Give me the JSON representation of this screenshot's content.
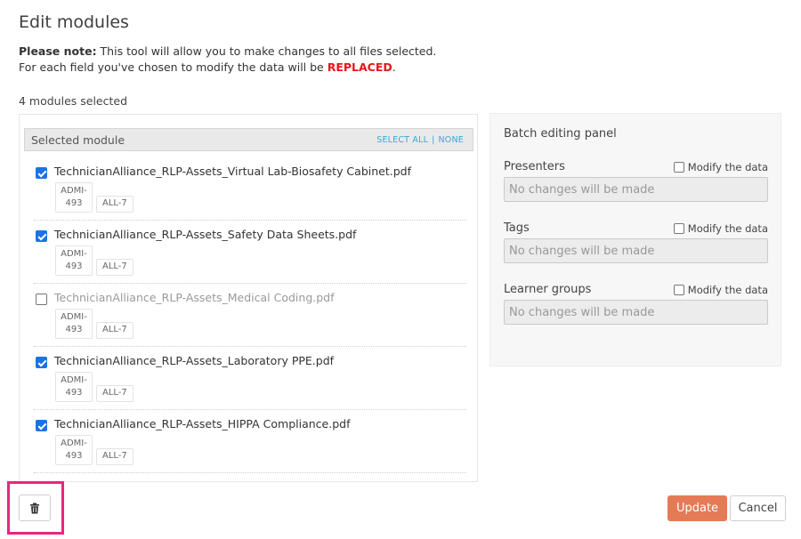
{
  "title": "Edit modules",
  "note": {
    "bold_label": "Please note:",
    "line1_rest": " This tool will allow you to make changes to all files selected.",
    "line2_prefix": "For each field you've chosen to modify the data will be ",
    "replaced": "REPLACED",
    "line2_suffix": "."
  },
  "selected_count": "4 modules selected",
  "left_panel": {
    "header": "Selected module",
    "select_all": "SELECT ALL",
    "separator": "|",
    "none": "NONE",
    "modules": [
      {
        "name": "TechnicianAlliance_RLP-Assets_Virtual Lab-Biosafety Cabinet.pdf",
        "checked": true,
        "tag1_line1": "ADMI-",
        "tag1_line2": "493",
        "tag2": "ALL-7"
      },
      {
        "name": "TechnicianAlliance_RLP-Assets_Safety Data Sheets.pdf",
        "checked": true,
        "tag1_line1": "ADMI-",
        "tag1_line2": "493",
        "tag2": "ALL-7"
      },
      {
        "name": "TechnicianAlliance_RLP-Assets_Medical Coding.pdf",
        "checked": false,
        "tag1_line1": "ADMI-",
        "tag1_line2": "493",
        "tag2": "ALL-7"
      },
      {
        "name": "TechnicianAlliance_RLP-Assets_Laboratory PPE.pdf",
        "checked": true,
        "tag1_line1": "ADMI-",
        "tag1_line2": "493",
        "tag2": "ALL-7"
      },
      {
        "name": "TechnicianAlliance_RLP-Assets_HIPPA Compliance.pdf",
        "checked": true,
        "tag1_line1": "ADMI-",
        "tag1_line2": "493",
        "tag2": "ALL-7"
      }
    ]
  },
  "right_panel": {
    "title": "Batch editing panel",
    "fields": [
      {
        "label": "Presenters",
        "modify_label": "Modify the data",
        "placeholder": "No changes will be made"
      },
      {
        "label": "Tags",
        "modify_label": "Modify the data",
        "placeholder": "No changes will be made"
      },
      {
        "label": "Learner groups",
        "modify_label": "Modify the data",
        "placeholder": "No changes will be made"
      }
    ]
  },
  "buttons": {
    "update": "Update",
    "cancel": "Cancel",
    "trash_icon": "trash-icon"
  },
  "colors": {
    "replaced": "#e8141b",
    "update_bg": "#e57a57",
    "link": "#3aa7d8",
    "highlight": "#e8267f",
    "checkbox": "#1a73e8"
  }
}
